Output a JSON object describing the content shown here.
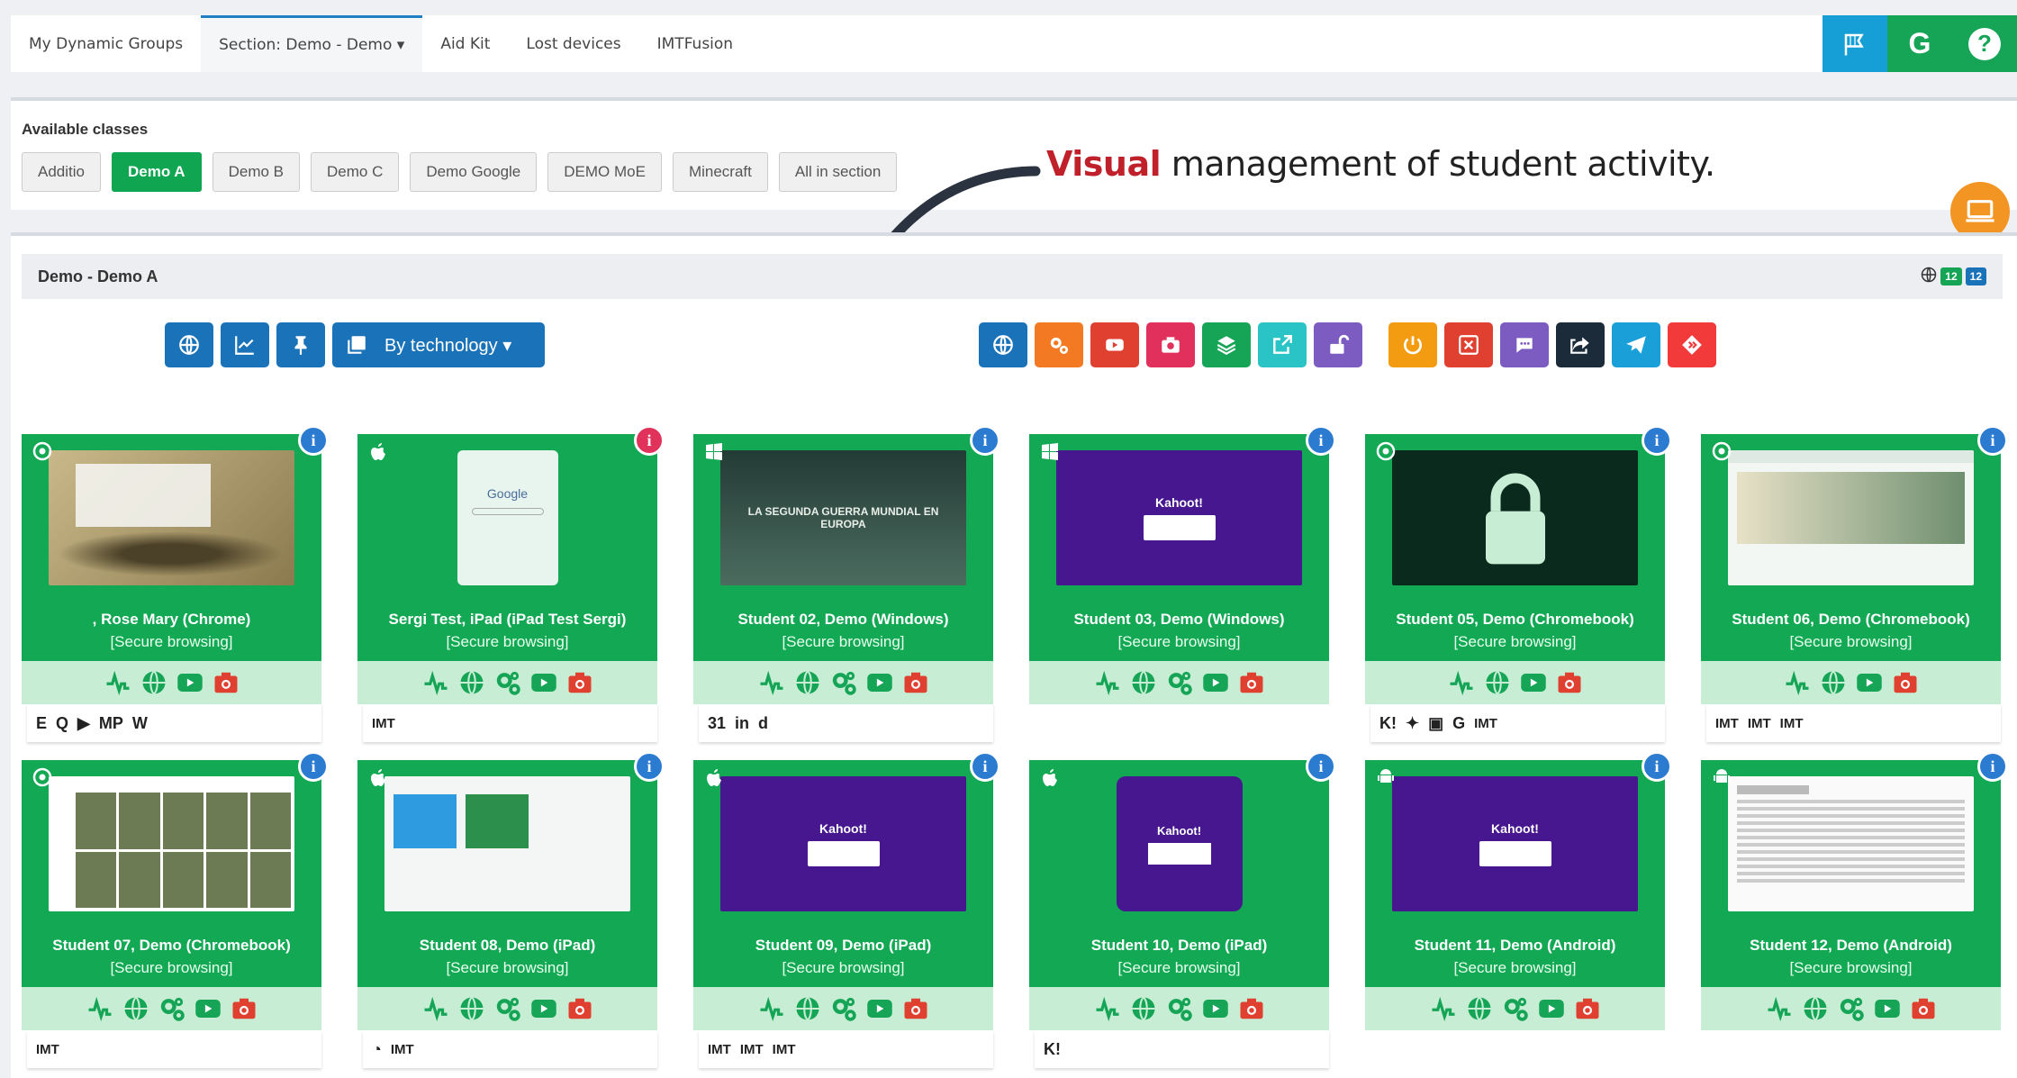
{
  "nav": {
    "tabs": [
      "My Dynamic Groups",
      "Section: Demo - Demo ▾",
      "Aid Kit",
      "Lost devices",
      "IMTFusion"
    ],
    "icons": [
      {
        "name": "flag-icon",
        "color": "#169ed6"
      },
      {
        "name": "google-icon",
        "color": "#16a556",
        "glyph": "G"
      },
      {
        "name": "help-icon",
        "color": "#16a556",
        "glyph": "?"
      }
    ]
  },
  "classes": {
    "title": "Available classes",
    "items": [
      "Additio",
      "Demo A",
      "Demo B",
      "Demo C",
      "Demo Google",
      "DEMO MoE",
      "Minecraft",
      "All in section"
    ],
    "active": "Demo A"
  },
  "annotation": {
    "highlight": "Visual",
    "text": " management of student activity."
  },
  "section": {
    "title": "Demo - Demo A",
    "count_green": "12",
    "count_blue": "12"
  },
  "toolbar": {
    "by_technology": "By technology ▾",
    "left_icons": [
      "globe-icon",
      "chart-icon",
      "pin-icon",
      "copy-icon"
    ],
    "middle_icons": [
      {
        "name": "globe-icon",
        "color": "#1a72b8"
      },
      {
        "name": "gears-icon",
        "color": "#f37a22"
      },
      {
        "name": "youtube-icon",
        "color": "#e04030"
      },
      {
        "name": "camera-icon",
        "color": "#e0305b"
      },
      {
        "name": "layers-icon",
        "color": "#16a556"
      },
      {
        "name": "external-link-icon",
        "color": "#2bc4c6"
      },
      {
        "name": "unlock-icon",
        "color": "#7c5cc0"
      }
    ],
    "right_icons": [
      {
        "name": "power-icon",
        "color": "#f39c12"
      },
      {
        "name": "close-window-icon",
        "color": "#e04030"
      },
      {
        "name": "chat-icon",
        "color": "#7c5cc0"
      },
      {
        "name": "share-icon",
        "color": "#1b2b3a"
      },
      {
        "name": "send-icon",
        "color": "#1a9fd8"
      },
      {
        "name": "diamond-arrows-icon",
        "color": "#f23a3a"
      }
    ]
  },
  "students": [
    {
      "name": ", Rose Mary (Chrome)",
      "mode": "[Secure browsing]",
      "os": "chrome",
      "info": "blue",
      "shot": "map",
      "actions": [
        "activity",
        "globe",
        "youtube",
        "camera"
      ],
      "apps": [
        "E",
        "Q",
        "▶",
        "MP",
        "W"
      ]
    },
    {
      "name": "Sergi Test, iPad (iPad Test Sergi)",
      "mode": "[Secure browsing]",
      "os": "apple",
      "info": "red",
      "shot": "google",
      "actions": [
        "activity",
        "globe",
        "gears",
        "youtube",
        "camera"
      ],
      "apps": [
        "IMT"
      ]
    },
    {
      "name": "Student 02, Demo (Windows)",
      "mode": "[Secure browsing]",
      "os": "windows",
      "info": "blue",
      "shot": "war",
      "actions": [
        "activity",
        "globe",
        "gears",
        "youtube",
        "camera"
      ],
      "apps": [
        "31",
        "in",
        "d"
      ]
    },
    {
      "name": "Student 03, Demo (Windows)",
      "mode": "[Secure browsing]",
      "os": "windows",
      "info": "blue",
      "shot": "kahoot",
      "actions": [
        "activity",
        "globe",
        "gears",
        "youtube",
        "camera"
      ],
      "apps": []
    },
    {
      "name": "Student 05, Demo (Chromebook)",
      "mode": "[Secure browsing]",
      "os": "chrome",
      "info": "blue",
      "shot": "lock",
      "actions": [
        "activity",
        "globe",
        "youtube",
        "camera"
      ],
      "apps": [
        "K!",
        "✦",
        "▣",
        "G",
        "IMT"
      ]
    },
    {
      "name": "Student 06, Demo (Chromebook)",
      "mode": "[Secure browsing]",
      "os": "chrome",
      "info": "blue",
      "shot": "web",
      "actions": [
        "activity",
        "globe",
        "youtube",
        "camera"
      ],
      "apps": [
        "IMT",
        "IMT",
        "IMT"
      ]
    },
    {
      "name": "Student 07, Demo (Chromebook)",
      "mode": "[Secure browsing]",
      "os": "chrome",
      "info": "blue",
      "shot": "youtube",
      "actions": [
        "activity",
        "globe",
        "gears",
        "youtube",
        "camera"
      ],
      "apps": [
        "IMT"
      ]
    },
    {
      "name": "Student 08, Demo (iPad)",
      "mode": "[Secure browsing]",
      "os": "apple",
      "info": "blue",
      "shot": "classroom",
      "actions": [
        "activity",
        "globe",
        "gears",
        "youtube",
        "camera"
      ],
      "apps": [
        "◔",
        "IMT"
      ]
    },
    {
      "name": "Student 09, Demo (iPad)",
      "mode": "[Secure browsing]",
      "os": "apple",
      "info": "blue",
      "shot": "kahoot",
      "actions": [
        "activity",
        "globe",
        "gears",
        "youtube",
        "camera"
      ],
      "apps": [
        "IMT",
        "IMT",
        "IMT"
      ]
    },
    {
      "name": "Student 10, Demo (iPad)",
      "mode": "[Secure browsing]",
      "os": "apple",
      "info": "blue",
      "shot": "kahoot-phone",
      "actions": [
        "activity",
        "globe",
        "gears",
        "youtube",
        "camera"
      ],
      "apps": [
        "K!"
      ]
    },
    {
      "name": "Student 11, Demo (Android)",
      "mode": "[Secure browsing]",
      "os": "android",
      "info": "blue",
      "shot": "kahoot",
      "actions": [
        "activity",
        "globe",
        "gears",
        "youtube",
        "camera"
      ],
      "apps": []
    },
    {
      "name": "Student 12, Demo (Android)",
      "mode": "[Secure browsing]",
      "os": "android",
      "info": "blue",
      "shot": "wiki",
      "actions": [
        "activity",
        "globe",
        "gears",
        "youtube",
        "camera"
      ],
      "apps": []
    }
  ],
  "screenshots": {
    "kahoot_title": "Kahoot!",
    "war_title": "LA SEGUNDA GUERRA MUNDIAL EN EUROPA"
  }
}
